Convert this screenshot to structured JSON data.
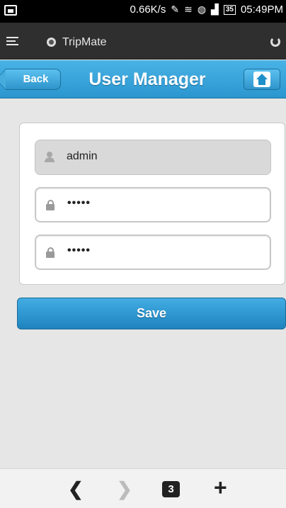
{
  "status_bar": {
    "speed": "0.66K/s",
    "battery": "35",
    "time": "05:49PM"
  },
  "browser": {
    "app_name": "TripMate"
  },
  "header": {
    "back_label": "Back",
    "title": "User Manager"
  },
  "form": {
    "username_value": "admin",
    "password_value": "•••••",
    "confirm_password_value": "•••••"
  },
  "actions": {
    "save_label": "Save"
  },
  "bottom_nav": {
    "back_glyph": "❮",
    "forward_glyph": "❯",
    "tab_count": "3",
    "new_tab_glyph": "+"
  },
  "colors": {
    "accent": "#2b96cf",
    "status_bar_bg": "#000000",
    "browser_bar_bg": "#2f2f2f",
    "page_bg": "#e6e6e6"
  }
}
